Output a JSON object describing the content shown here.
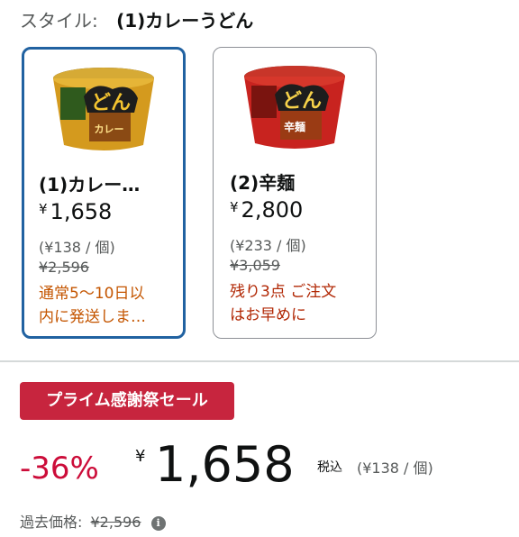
{
  "style_selector": {
    "label": "スタイル:",
    "selected": "(1)カレーうどん"
  },
  "options": [
    {
      "name": "(1)カレー…",
      "currency": "¥",
      "price": "1,658",
      "unit_price": "(¥138 / 個)",
      "list_price": "¥2,596",
      "availability_line1": "通常5〜10日以",
      "availability_line2": "内に発送しま…",
      "selected": true,
      "cup_logo_text": "どん",
      "cup_logo_sub": "カレー",
      "cup_color": "#d49a1e"
    },
    {
      "name": "(2)辛麺",
      "currency": "¥",
      "price": "2,800",
      "unit_price": "(¥233 / 個)",
      "list_price": "¥3,059",
      "availability_line1": "残り3点 ご注文",
      "availability_line2": "はお早めに",
      "selected": false,
      "cup_logo_text": "どん",
      "cup_logo_sub": "辛麺",
      "cup_color": "#c8231f"
    }
  ],
  "deal": {
    "badge": "プライム感謝祭セール",
    "discount": "-36%",
    "currency": "¥",
    "price": "1,658",
    "tax_label": "税込",
    "unit_price": "(¥138 / 個)"
  },
  "past_price": {
    "label": "過去価格:",
    "value": "¥2,596"
  },
  "colors": {
    "selected_border": "#2162a1",
    "badge_bg": "#c7253e",
    "discount": "#cc0c39",
    "ship": "#c45500",
    "low_stock": "#b12704"
  }
}
